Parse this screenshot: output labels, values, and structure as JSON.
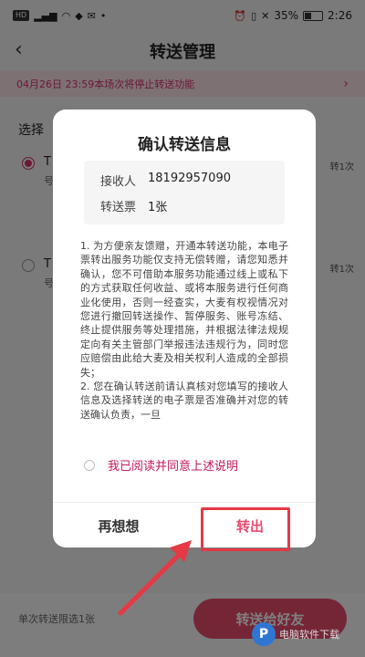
{
  "status_bar": {
    "battery_text": "35%",
    "time": "2:26"
  },
  "header": {
    "title": "转送管理"
  },
  "notice": {
    "text": "04月26日 23:59本场次将停止转送功能"
  },
  "background": {
    "choose_label": "选择",
    "item_letters": [
      "T",
      "T"
    ],
    "item_sub": [
      "号",
      "号"
    ],
    "side_tags": [
      "转1次",
      "转1次"
    ],
    "bottom_note": "单次转送限选1张",
    "bottom_button_label": "转送给好友"
  },
  "dialog": {
    "title": "确认转送信息",
    "recipient_label": "接收人",
    "recipient_value": "18192957090",
    "ticket_label": "转送票",
    "ticket_value": "1张",
    "terms": "1. 为方便亲友馈赠，开通本转送功能，本电子票转出服务功能仅支持无偿转赠，请您知悉并确认，您不可借助本服务功能通过线上或私下的方式获取任何收益、或将本服务进行任何商业化使用，否则一经查实，大麦有权视情况对您进行撤回转送操作、暂停服务、账号冻结、终止提供服务等处理措施，并根据法律法规规定向有关主管部门举报违法违规行为，同时您应赔偿由此给大麦及相关权利人造成的全部损失；\n2. 您在确认转送前请认真核对您填写的接收人信息及选择转送的电子票是否准确并对您的转送确认负责，一旦",
    "agree_text": "我已阅读并同意上述说明",
    "cancel_label": "再想想",
    "confirm_label": "转出"
  },
  "watermark": {
    "text": "电脑软件下载"
  },
  "colors": {
    "accent": "#e84c6e",
    "highlight": "#e53945",
    "notice_bg": "#fbe3e9"
  }
}
